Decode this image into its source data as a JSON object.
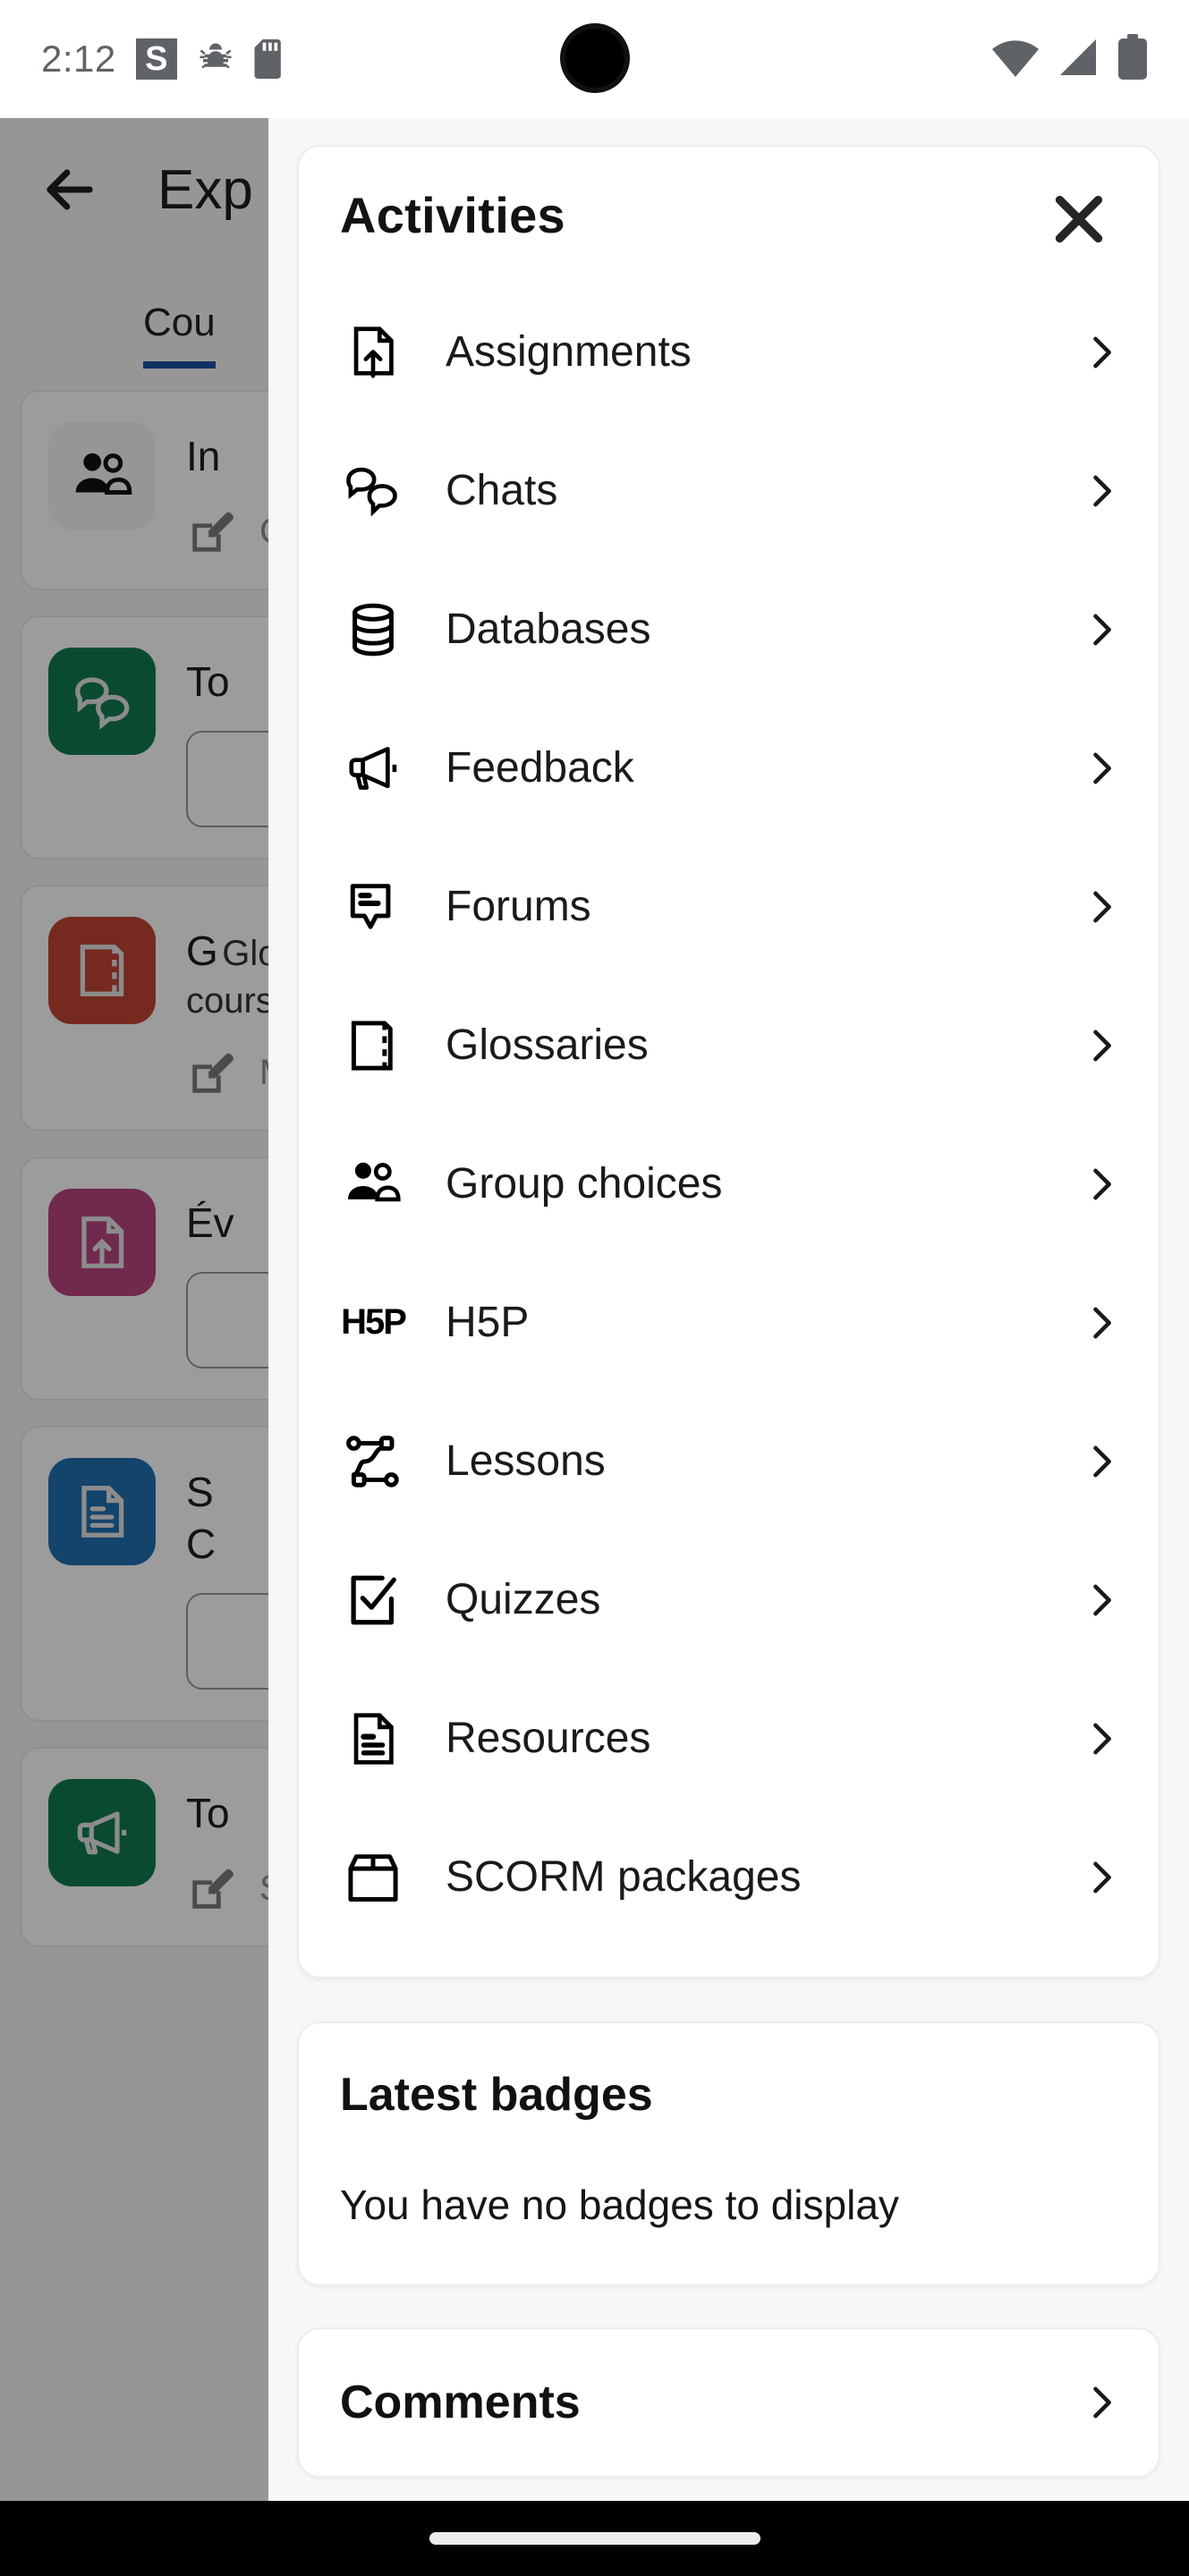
{
  "status_bar": {
    "time": "2:12",
    "badge_letter": "S",
    "icons": [
      "app-badge-icon",
      "bug-icon",
      "sd-card-icon",
      "wifi-icon",
      "cellular-signal-icon",
      "battery-icon"
    ]
  },
  "background_page": {
    "back_label": "back-arrow-icon",
    "title": "Exp",
    "tab_label": "Cou",
    "items": [
      {
        "title": "In",
        "action_label": "Choos",
        "tile_color": "rgba(0,0,0,0.04)",
        "icon": "people-icon"
      },
      {
        "title": "To",
        "desc": "",
        "tile_color": "#117a4e",
        "icon": "chat-bubbles-icon"
      },
      {
        "title": "G",
        "desc": "Glossaire c\ncours ou un",
        "action_label": "Make",
        "tile_color": "#bf4433",
        "icon": "book-icon"
      },
      {
        "title": "Év",
        "desc": "",
        "tile_color": "#b7437c",
        "icon": "assignment-icon"
      },
      {
        "title": "S\nC",
        "desc": "",
        "tile_color": "#1f6fae",
        "icon": "resource-icon"
      },
      {
        "title": "To",
        "action_label": "Submi",
        "tile_color": "#117a4e",
        "icon": "megaphone-icon"
      }
    ]
  },
  "modal": {
    "title": "Activities",
    "close_label": "close-icon",
    "activities": [
      {
        "label": "Assignments",
        "icon": "assignment-icon"
      },
      {
        "label": "Chats",
        "icon": "chat-bubbles-icon"
      },
      {
        "label": "Databases",
        "icon": "database-icon"
      },
      {
        "label": "Feedback",
        "icon": "megaphone-icon"
      },
      {
        "label": "Forums",
        "icon": "forum-icon"
      },
      {
        "label": "Glossaries",
        "icon": "book-icon"
      },
      {
        "label": "Group choices",
        "icon": "people-icon"
      },
      {
        "label": "H5P",
        "icon": "h5p-logo-icon"
      },
      {
        "label": "Lessons",
        "icon": "lesson-path-icon"
      },
      {
        "label": "Quizzes",
        "icon": "checkbox-check-icon"
      },
      {
        "label": "Resources",
        "icon": "resource-icon"
      },
      {
        "label": "SCORM packages",
        "icon": "package-box-icon"
      }
    ],
    "badges": {
      "title": "Latest badges",
      "empty_message": "You have no badges to display"
    },
    "comments": {
      "title": "Comments"
    }
  },
  "colors": {
    "accent_blue": "#1b4fa0",
    "scrim": "rgba(0,0,0,0.38)",
    "modal_bg": "#f7f7f7",
    "card_bg": "#ffffff",
    "text_primary": "#1a1a1a"
  }
}
